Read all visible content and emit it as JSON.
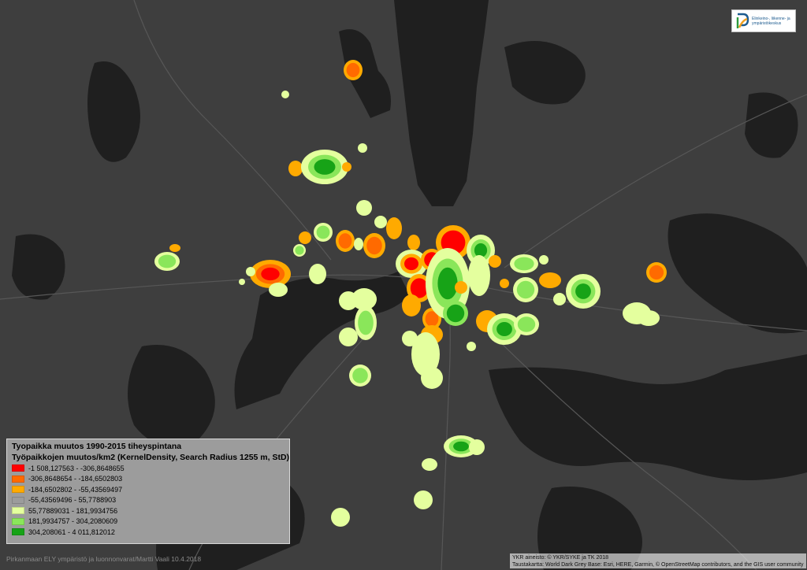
{
  "map": {
    "background_color": "#3e3e3e",
    "water_color": "#1f1f1f",
    "road_color": "#555555",
    "classes": [
      {
        "label": "-1 508,127563 - -306,8648655",
        "color": "#ff0000"
      },
      {
        "label": "-306,8648654 - -184,6502803",
        "color": "#ff6a00"
      },
      {
        "label": "-184,6502802 - -55,43569497",
        "color": "#ffaa00"
      },
      {
        "label": "-55,43569496 - 55,7788903",
        "color": "#9c9c9c"
      },
      {
        "label": "55,77889031 - 181,9934756",
        "color": "#e4ff9e"
      },
      {
        "label": "181,9934757 - 304,2080609",
        "color": "#8ae65a"
      },
      {
        "label": "304,208061 - 4 011,812012",
        "color": "#17a317"
      }
    ]
  },
  "legend": {
    "title": "Tyopaikka muutos 1990-2015 tiheyspintana",
    "subtitle": "Työpaikkojen muutos/km2 (KernelDensity, Search Radius 1255 m, StD)"
  },
  "logo": {
    "text_line1": "Elinkeino-, liikenne- ja",
    "text_line2": "ympäristökeskus"
  },
  "credits": {
    "left": "Pirkanmaan ELY ympäristö ja luonnonvarat/Martti Vaali 10.4.2018",
    "right_line1": "YKR aineisto: © YKR/SYKE ja TK 2018",
    "right_line2": "Taustakartta: World Dark Grey Base: Esri, HERE, Garmin, © OpenStreetMap contributors, and the GIS user community"
  }
}
